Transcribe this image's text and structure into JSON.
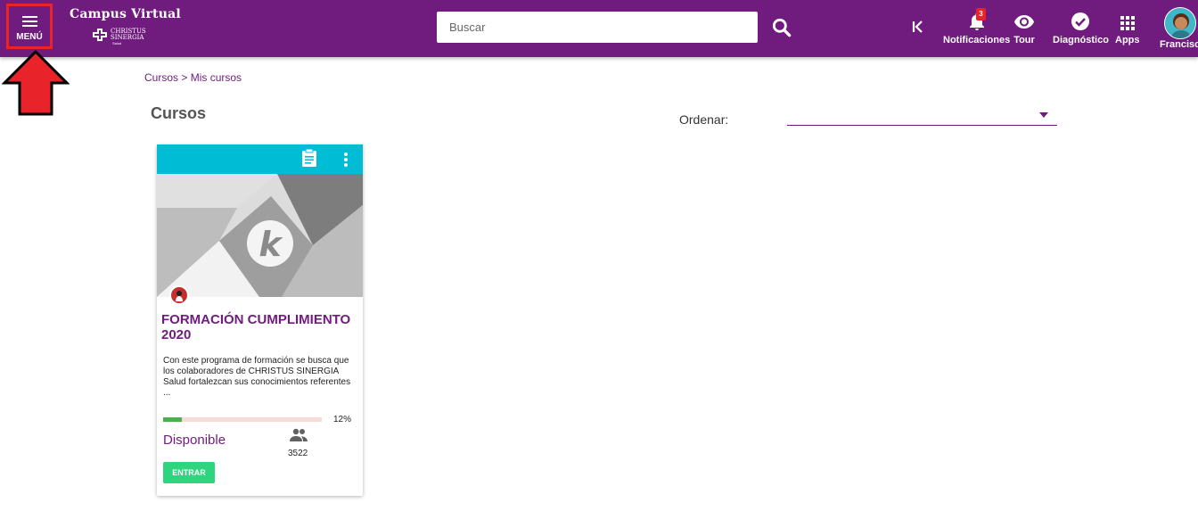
{
  "header": {
    "menu_label": "MENÚ",
    "app_title": "Campus Virtual",
    "logo_line1": "CHRISTUS",
    "logo_line2": "SINERGIA",
    "logo_line3": "Salud",
    "search_placeholder": "Buscar",
    "notifications_label": "Notificaciones",
    "notifications_count": "3",
    "tour_label": "Tour",
    "diagnostic_label": "Diagnóstico",
    "apps_label": "Apps",
    "user_name": "Francisco"
  },
  "breadcrumb": {
    "items": [
      "Cursos",
      "Mis cursos"
    ],
    "separator": ">"
  },
  "page": {
    "title": "Cursos",
    "sort_label": "Ordenar:",
    "sort_value": ""
  },
  "course": {
    "title": "FORMACIÓN CUMPLIMIENTO 2020",
    "description": "Con este programa de formación se busca que los colaboradores de CHRISTUS SINERGIA Salud fortalezcan sus conocimientos referentes ...",
    "progress_percent": 12,
    "progress_label": "12%",
    "status": "Disponible",
    "participants": "3522",
    "enter_label": "ENTRAR"
  },
  "colors": {
    "primary": "#701b7e",
    "card_header": "#00bcd4",
    "progress_fill": "#4caf50",
    "enter_button": "#2ed47e",
    "annotation_red": "#e8232a"
  }
}
